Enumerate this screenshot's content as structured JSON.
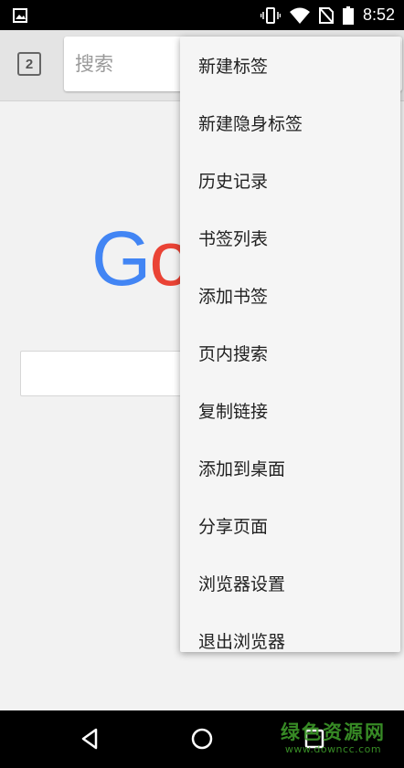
{
  "status_bar": {
    "time": "8:52",
    "icons": [
      "gallery-icon",
      "vibrate-icon",
      "wifi-icon",
      "no-sim-icon",
      "battery-icon"
    ]
  },
  "toolbar": {
    "tab_count": "2",
    "search_placeholder": "搜索"
  },
  "page": {
    "logo_text": "Go",
    "logo_colors": {
      "G": "#4285f4",
      "o": "#ea4335"
    }
  },
  "menu": {
    "items": [
      {
        "label": "新建标签"
      },
      {
        "label": "新建隐身标签"
      },
      {
        "label": "历史记录"
      },
      {
        "label": "书签列表"
      },
      {
        "label": "添加书签"
      },
      {
        "label": "页内搜索"
      },
      {
        "label": "复制链接"
      },
      {
        "label": "添加到桌面"
      },
      {
        "label": "分享页面"
      },
      {
        "label": "浏览器设置"
      },
      {
        "label": "退出浏览器"
      }
    ]
  },
  "nav_bar": {
    "icons": [
      "back-icon",
      "home-icon",
      "recents-icon"
    ]
  },
  "watermark": {
    "title": "绿色资源网",
    "url": "www.downcc.com"
  }
}
